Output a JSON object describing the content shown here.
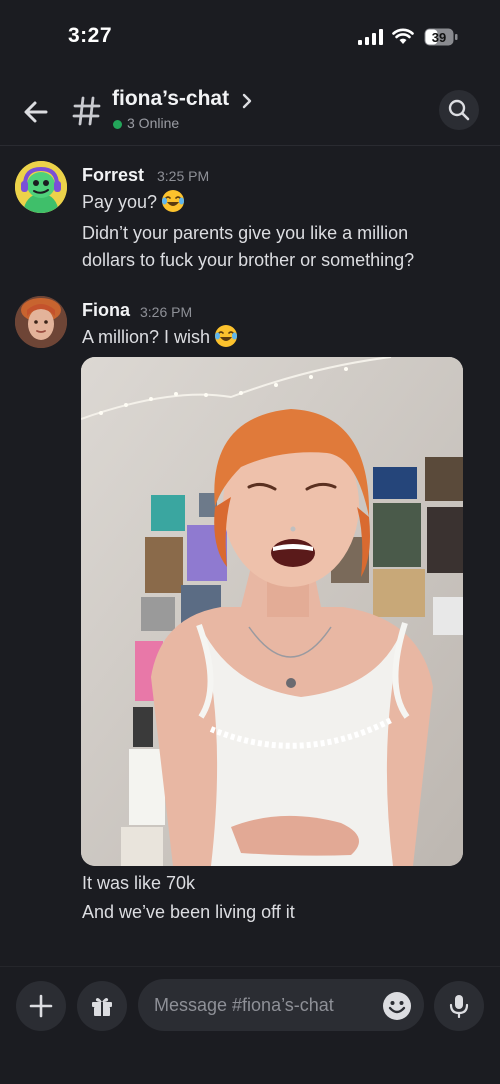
{
  "status_bar": {
    "time": "3:27",
    "battery": "39"
  },
  "header": {
    "channel_name": "fiona’s-chat",
    "online_status": "3 Online"
  },
  "messages": [
    {
      "author": "Forrest",
      "timestamp": "3:25 PM",
      "lines": [
        "Pay you?",
        "Didn’t your parents give you like a million",
        "dollars to fuck your brother or something?"
      ],
      "emoji": "laughing-tears"
    },
    {
      "author": "Fiona",
      "timestamp": "3:26 PM",
      "lines": [
        "A million? I wish"
      ],
      "emoji": "laughing-tears",
      "has_photo": true,
      "after_photo_lines": [
        "It was like 70k",
        "And we’ve been living off it"
      ]
    }
  ],
  "composer": {
    "placeholder": "Message #fiona’s-chat"
  },
  "colors": {
    "background": "#1b1c21",
    "online": "#23a55a",
    "surface": "#2b2d33"
  }
}
